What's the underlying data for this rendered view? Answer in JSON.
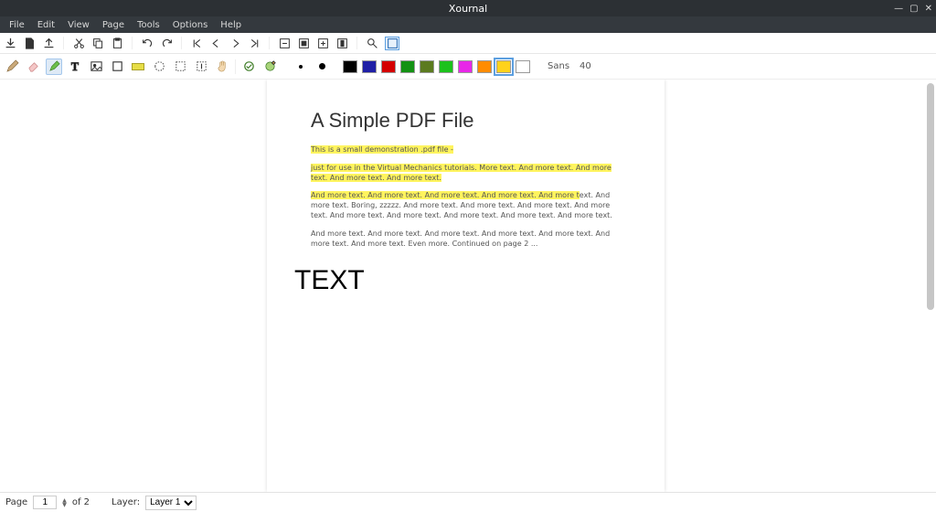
{
  "app": {
    "title": "Xournal"
  },
  "menubar": [
    "File",
    "Edit",
    "View",
    "Page",
    "Tools",
    "Options",
    "Help"
  ],
  "toolbar_icons": [
    "save-icon",
    "new-icon",
    "open-icon",
    "|",
    "cut-icon",
    "copy-icon",
    "paste-icon",
    "|",
    "undo-icon",
    "redo-icon",
    "|",
    "first-page-icon",
    "prev-page-icon",
    "next-page-icon",
    "last-page-icon",
    "|",
    "zoom-out-icon",
    "zoom-fit-icon",
    "zoom-in-icon",
    "zoom-width-icon",
    "|",
    "find-icon",
    "fullscreen-icon"
  ],
  "toolbtns": {
    "tools": [
      "pencil-tool",
      "eraser-tool",
      "highlighter-tool",
      "text-tool",
      "image-tool",
      "shape-tool",
      "highlight-box-tool",
      "select-region-tool",
      "select-rect-tool",
      "vertical-space-tool",
      "hand-tool",
      "|",
      "layer-visible-icon",
      "layer-add-icon"
    ],
    "selected_tool": "highlighter-tool",
    "thickness": [
      "dot-small",
      "dot-med"
    ],
    "colors": [
      {
        "name": "black",
        "hex": "#000000"
      },
      {
        "name": "darkblue",
        "hex": "#1f1fa5"
      },
      {
        "name": "red",
        "hex": "#d40000"
      },
      {
        "name": "green",
        "hex": "#149214"
      },
      {
        "name": "darkgreen",
        "hex": "#5b7a1f"
      },
      {
        "name": "cyan",
        "hex": "#1cc11c"
      },
      {
        "name": "magenta",
        "hex": "#e826e8"
      },
      {
        "name": "orange",
        "hex": "#ff8c00"
      },
      {
        "name": "yellow",
        "hex": "#ffd21c"
      },
      {
        "name": "white",
        "hex": "#ffffff"
      }
    ],
    "selected_color": "yellow",
    "font_name": "Sans",
    "font_size": "40"
  },
  "document": {
    "title": "A Simple PDF File",
    "para1": "This is a small demonstration .pdf file -",
    "para2": "just for use in the Virtual Mechanics tutorials. More text. And more text. And more text. And more text. And more text.",
    "para3": "And more text. And more text. And more text. And more text. And more text. And more text. Boring, zzzzz. And more text. And more text. And more text. And more text. And more text. And more text. And more text. And more text. And more text.",
    "para4": "And more text. And more text. And more text. And more text. And more text. And more text. And more text. Even more. Continued on page 2 ...",
    "annotation_text": "TEXT"
  },
  "statusbar": {
    "page_label": "Page",
    "page_current": "1",
    "page_total": "of 2",
    "layer_label": "Layer:",
    "layer_value": "Layer 1"
  },
  "highlights": [
    {
      "para": 1,
      "mode": "all"
    },
    {
      "para": 2,
      "mode": "all"
    },
    {
      "para": 3,
      "mode": "first-line"
    }
  ]
}
